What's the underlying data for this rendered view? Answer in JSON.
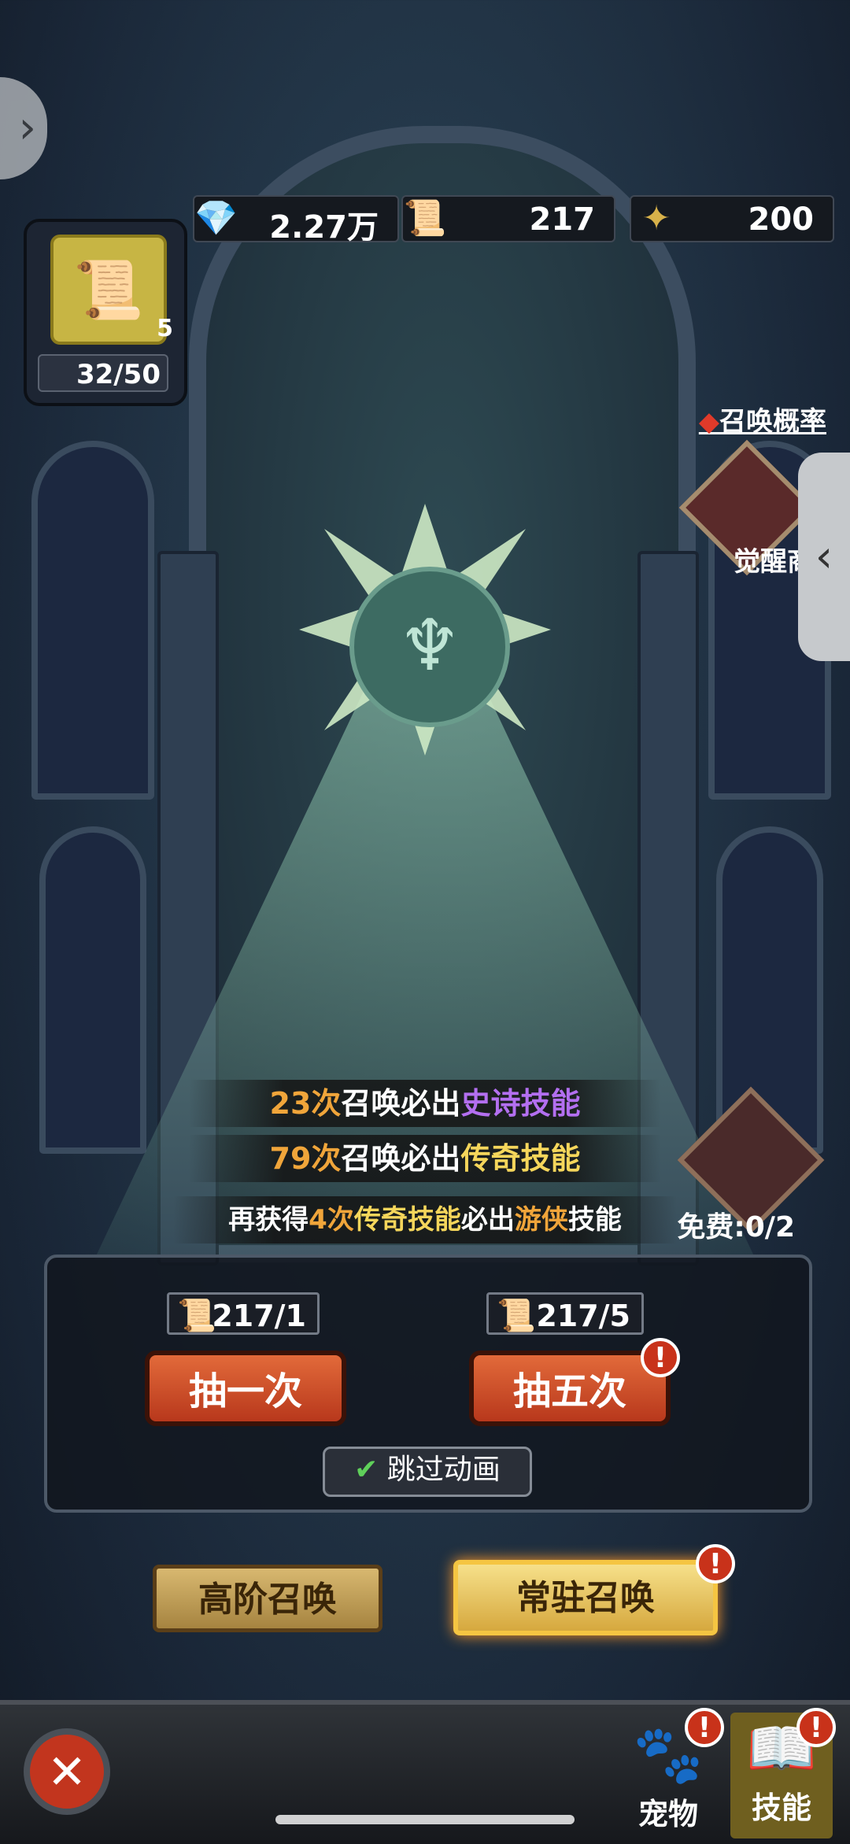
{
  "currencies": [
    {
      "icon": "diamond-icon",
      "value": "2.27万"
    },
    {
      "icon": "scroll-icon",
      "value": "217"
    },
    {
      "icon": "cross-icon",
      "value": "200"
    }
  ],
  "item": {
    "count": "5",
    "progress": "32/50"
  },
  "side": {
    "probability": "召唤概率",
    "awaken_shop": "觉醒商"
  },
  "info": {
    "line1": {
      "count": "23次",
      "mid": "召唤必出",
      "reward": "史诗技能"
    },
    "line2": {
      "count": "79次",
      "mid": "召唤必出",
      "reward": "传奇技能"
    },
    "line3": {
      "pre": "再获得",
      "count": "4次",
      "reward": "传奇技能",
      "mid": "必出",
      "hero": "游侠",
      "post": "技能"
    }
  },
  "free": {
    "label": "免费:0/2"
  },
  "draw": {
    "single": {
      "cost": "217/1",
      "label": "抽一次"
    },
    "five": {
      "cost": "217/5",
      "label": "抽五次"
    },
    "skip": "跳过动画"
  },
  "tabs": {
    "advanced": "高阶召唤",
    "standard": "常驻召唤"
  },
  "nav": {
    "pet": "宠物",
    "skill": "技能"
  },
  "alert_mark": "!",
  "colors": {
    "accent_orange": "#f0a53a",
    "epic_purple": "#b36ff0",
    "legend_gold": "#f5d65b",
    "button_red": "#c8461f"
  }
}
